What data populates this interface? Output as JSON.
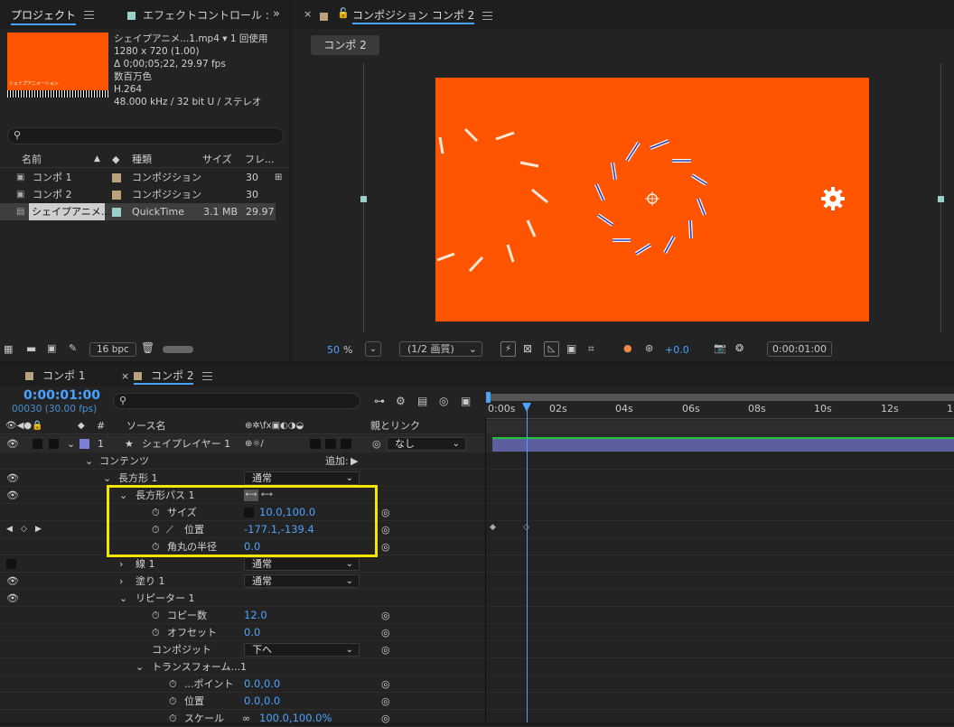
{
  "project_panel": {
    "tab_label": "プロジェクト",
    "effect_tab_label": "エフェクトコントロール :",
    "menu_icon": "hamburger-icon",
    "thumb_caption": "シェイプアニメーション",
    "file_name": "シェイプアニメ...1.mp4",
    "usage": "1 回使用",
    "resolution": "1280 x 720 (1.00)",
    "duration": "Δ 0;00;05;22, 29.97 fps",
    "colors": "数百万色",
    "codec": "H.264",
    "audio": "48.000 kHz / 32 bit U / ステレオ",
    "search_placeholder": "",
    "columns": {
      "name": "名前",
      "type": "種類",
      "size": "サイズ",
      "frame": "フレ..."
    },
    "items": [
      {
        "name": "コンポ 1",
        "type": "コンポジション",
        "size": "",
        "frame": "30"
      },
      {
        "name": "コンポ 2",
        "type": "コンポジション",
        "size": "",
        "frame": "30"
      },
      {
        "name": "シェイプアニメ...",
        "type": "QuickTime",
        "size": "3.1 MB",
        "frame": "29.97"
      }
    ],
    "bpc": "16 bpc"
  },
  "comp_panel": {
    "title": "コンポジション コンポ 2",
    "breadcrumb": "コンポ 2",
    "zoom_value": "50",
    "zoom_unit": "%",
    "quality": "(1/2 画質)",
    "exposure": "+0.0",
    "timecode": "0:00:01:00",
    "canvas_color": "#ff5500"
  },
  "timeline": {
    "tabs": [
      {
        "label": "コンポ 1"
      },
      {
        "label": "コンポ 2"
      }
    ],
    "timecode": "0:00:01:00",
    "frames": "00030 (30.00 fps)",
    "search_placeholder": "",
    "header": {
      "hash": "#",
      "source_name": "ソース名",
      "parent": "親とリンク"
    },
    "ruler": [
      "0:00s",
      "02s",
      "04s",
      "06s",
      "08s",
      "10s",
      "12s",
      "1"
    ],
    "layer": {
      "index": "1",
      "name": "シェイプレイヤー 1",
      "parent": "なし"
    },
    "contents_label": "コンテンツ",
    "add_label": "追加:",
    "properties": [
      {
        "label": "長方形 1",
        "value": "通常"
      },
      {
        "label": "長方形パス 1",
        "value": ""
      },
      {
        "label": "サイズ",
        "value": "10.0,100.0"
      },
      {
        "label": "位置",
        "value": "-177.1,-139.4"
      },
      {
        "label": "角丸の半径",
        "value": "0.0"
      },
      {
        "label": "線 1",
        "value": "通常"
      },
      {
        "label": "塗り 1",
        "value": "通常"
      },
      {
        "label": "リピーター 1",
        "value": ""
      },
      {
        "label": "コピー数",
        "value": "12.0"
      },
      {
        "label": "オフセット",
        "value": "0.0"
      },
      {
        "label": "コンポジット",
        "value": "下へ"
      },
      {
        "label": "トランスフォーム...1",
        "value": ""
      },
      {
        "label": "...ポイント",
        "value": "0.0,0.0"
      },
      {
        "label": "位置",
        "value": "0.0,0.0"
      },
      {
        "label": "スケール",
        "value": "100.0,100.0%"
      }
    ]
  },
  "colors": {
    "accent": "#4aa3ff",
    "highlight": "#f5e600",
    "layer_bar": "#5b5f9e",
    "label_swatch": "#b9a37f"
  }
}
